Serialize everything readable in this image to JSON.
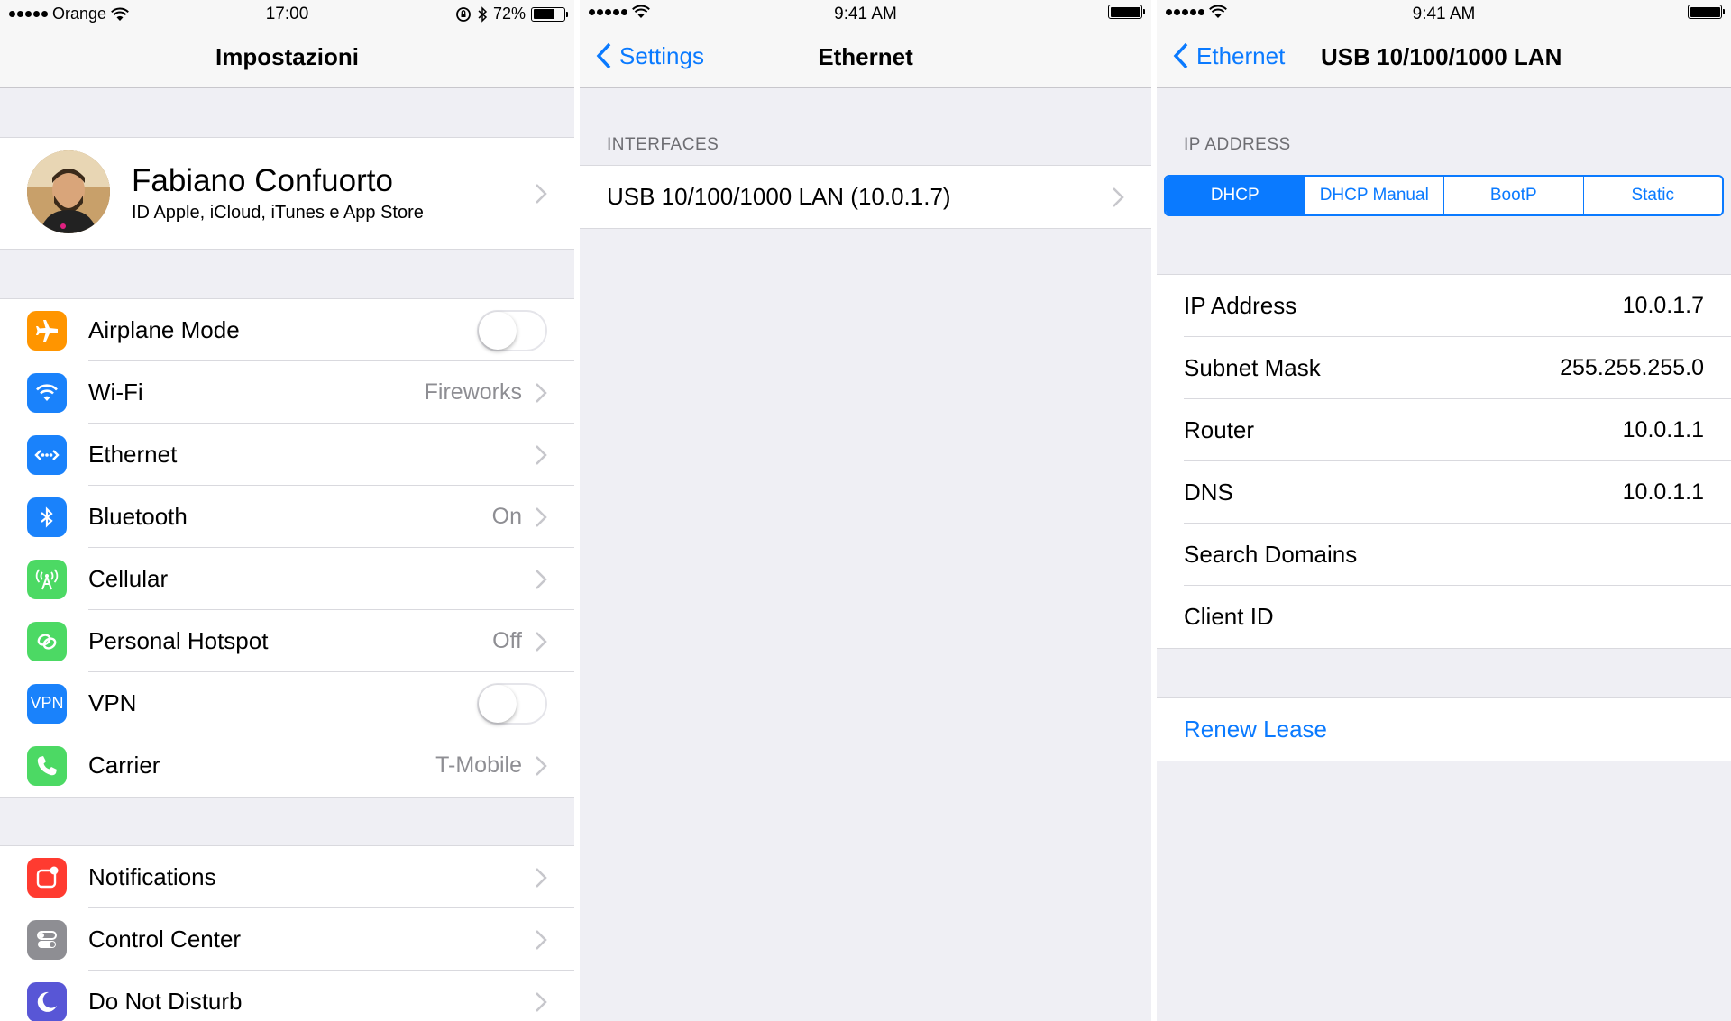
{
  "panel1": {
    "status": {
      "carrier": "Orange",
      "time": "17:00",
      "battery": "72%"
    },
    "nav_title": "Impostazioni",
    "profile": {
      "name": "Fabiano Confuorto",
      "subtitle": "ID Apple, iCloud, iTunes e App Store"
    },
    "items": [
      {
        "label": "Airplane Mode",
        "icon": "airplane-icon",
        "color": "#ff9500",
        "toggle": false
      },
      {
        "label": "Wi-Fi",
        "icon": "wifi-icon",
        "color": "#1a82fb",
        "value": "Fireworks"
      },
      {
        "label": "Ethernet",
        "icon": "ethernet-icon",
        "color": "#1a82fb",
        "value": ""
      },
      {
        "label": "Bluetooth",
        "icon": "bluetooth-icon",
        "color": "#1a82fb",
        "value": "On"
      },
      {
        "label": "Cellular",
        "icon": "cellular-icon",
        "color": "#4cd964",
        "value": ""
      },
      {
        "label": "Personal Hotspot",
        "icon": "hotspot-icon",
        "color": "#4cd964",
        "value": "Off"
      },
      {
        "label": "VPN",
        "icon": "vpn-icon",
        "icon_text": "VPN",
        "color": "#1a82fb",
        "toggle": false
      },
      {
        "label": "Carrier",
        "icon": "phone-icon",
        "color": "#4cd964",
        "value": "T-Mobile"
      }
    ],
    "items2": [
      {
        "label": "Notifications",
        "icon": "notifications-icon",
        "color": "#ff3b30"
      },
      {
        "label": "Control Center",
        "icon": "control-center-icon",
        "color": "#8e8e93"
      },
      {
        "label": "Do Not Disturb",
        "icon": "moon-icon",
        "color": "#5856d6"
      }
    ]
  },
  "panel2": {
    "status": {
      "time": "9:41 AM"
    },
    "back_label": "Settings",
    "nav_title": "Ethernet",
    "section_header": "INTERFACES",
    "interface_label": "USB 10/100/1000 LAN (10.0.1.7)"
  },
  "panel3": {
    "status": {
      "time": "9:41 AM"
    },
    "back_label": "Ethernet",
    "nav_title": "USB 10/100/1000 LAN",
    "section_header": "IP ADDRESS",
    "segments": [
      "DHCP",
      "DHCP Manual",
      "BootP",
      "Static"
    ],
    "active_segment": "DHCP",
    "fields": [
      {
        "label": "IP Address",
        "value": "10.0.1.7"
      },
      {
        "label": "Subnet Mask",
        "value": "255.255.255.0"
      },
      {
        "label": "Router",
        "value": "10.0.1.1"
      },
      {
        "label": "DNS",
        "value": "10.0.1.1"
      },
      {
        "label": "Search Domains",
        "value": ""
      },
      {
        "label": "Client ID",
        "value": ""
      }
    ],
    "renew_label": "Renew Lease"
  }
}
